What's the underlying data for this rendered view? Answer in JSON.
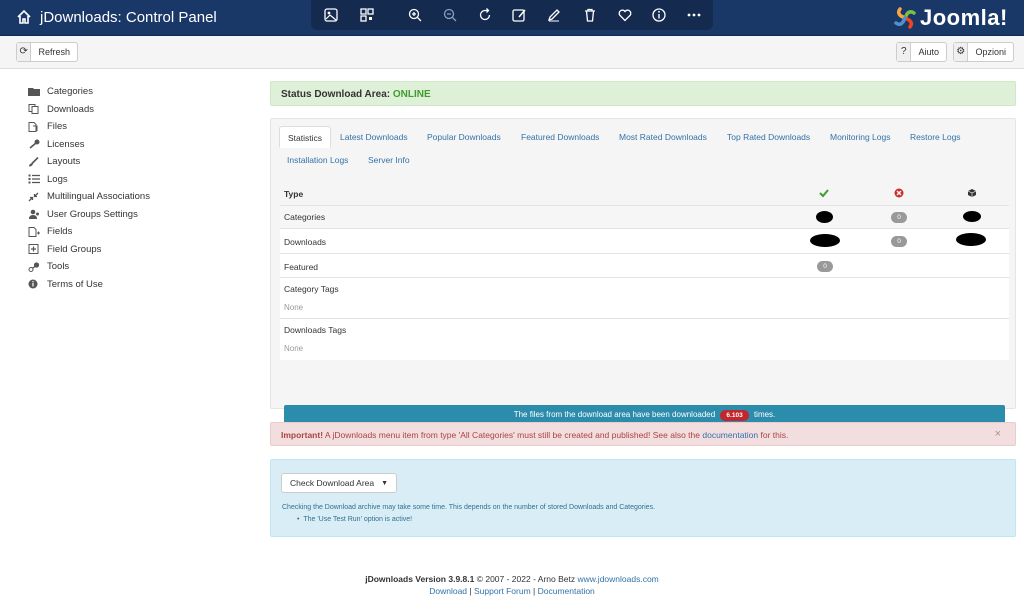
{
  "header": {
    "title": "jDownloads: Control Panel",
    "logo_text": "Joomla!",
    "bg": "#1a3867"
  },
  "viewer_toolbar": {
    "icons": [
      "image-icon",
      "qr-icon",
      "zoom-in-icon",
      "zoom-out-icon",
      "rotate-icon",
      "edit-image-icon",
      "pen-icon",
      "trash-icon",
      "heart-icon",
      "info-icon",
      "more-icon"
    ]
  },
  "toolbar": {
    "refresh_label": "Refresh",
    "help_label": "Aiuto",
    "options_label": "Opzioni"
  },
  "sidebar": {
    "items": [
      {
        "label": "Categories",
        "icon": "folder-icon"
      },
      {
        "label": "Downloads",
        "icon": "copy-icon"
      },
      {
        "label": "Files",
        "icon": "files-icon"
      },
      {
        "label": "Licenses",
        "icon": "key-icon"
      },
      {
        "label": "Layouts",
        "icon": "brush-icon"
      },
      {
        "label": "Logs",
        "icon": "list-icon"
      },
      {
        "label": "Multilingual Associations",
        "icon": "shrink-icon"
      },
      {
        "label": "User Groups Settings",
        "icon": "users-icon"
      },
      {
        "label": "Fields",
        "icon": "file-plus-icon"
      },
      {
        "label": "Field Groups",
        "icon": "box-plus-icon"
      },
      {
        "label": "Tools",
        "icon": "wrench-icon"
      },
      {
        "label": "Terms of Use",
        "icon": "info-circle-icon"
      }
    ]
  },
  "status": {
    "prefix": "Status Download Area:",
    "value": "ONLINE"
  },
  "tabs": [
    {
      "label": "Statistics",
      "active": true
    },
    {
      "label": "Latest Downloads"
    },
    {
      "label": "Popular Downloads"
    },
    {
      "label": "Featured Downloads"
    },
    {
      "label": "Most Rated Downloads"
    },
    {
      "label": "Top Rated Downloads"
    },
    {
      "label": "Monitoring Logs"
    },
    {
      "label": "Restore Logs"
    },
    {
      "label": "Installation Logs"
    },
    {
      "label": "Server Info"
    }
  ],
  "stats": {
    "header": "Type",
    "rows": [
      {
        "label": "Categories",
        "unpublished": "0"
      },
      {
        "label": "Downloads",
        "unpublished": "0"
      },
      {
        "label": "Featured",
        "published": "0"
      }
    ],
    "category_tags": {
      "label": "Category Tags",
      "value": "None"
    },
    "downloads_tags": {
      "label": "Downloads Tags",
      "value": "None"
    },
    "download_bar": {
      "prefix": "The files from the download area have been downloaded",
      "count": "6.103",
      "suffix": "times."
    }
  },
  "important": {
    "bold": "Important!",
    "text": " A jDownloads menu item from type 'All Categories' must still be created and published! See also the ",
    "link": "documentation",
    "tail": " for this."
  },
  "check": {
    "button": "Check Download Area",
    "note": "Checking the Download archive may take some time. This depends on the number of stored Downloads and Categories.",
    "bullet": "The 'Use Test Run' option is active!"
  },
  "footer": {
    "version_bold": "jDownloads Version 3.9.8.1",
    "copyright": " © 2007 - 2022 - Arno Betz ",
    "site": "www.jdownloads.com",
    "link1": "Download",
    "link2": "Support Forum",
    "link3": "Documentation",
    "sep": " | "
  }
}
